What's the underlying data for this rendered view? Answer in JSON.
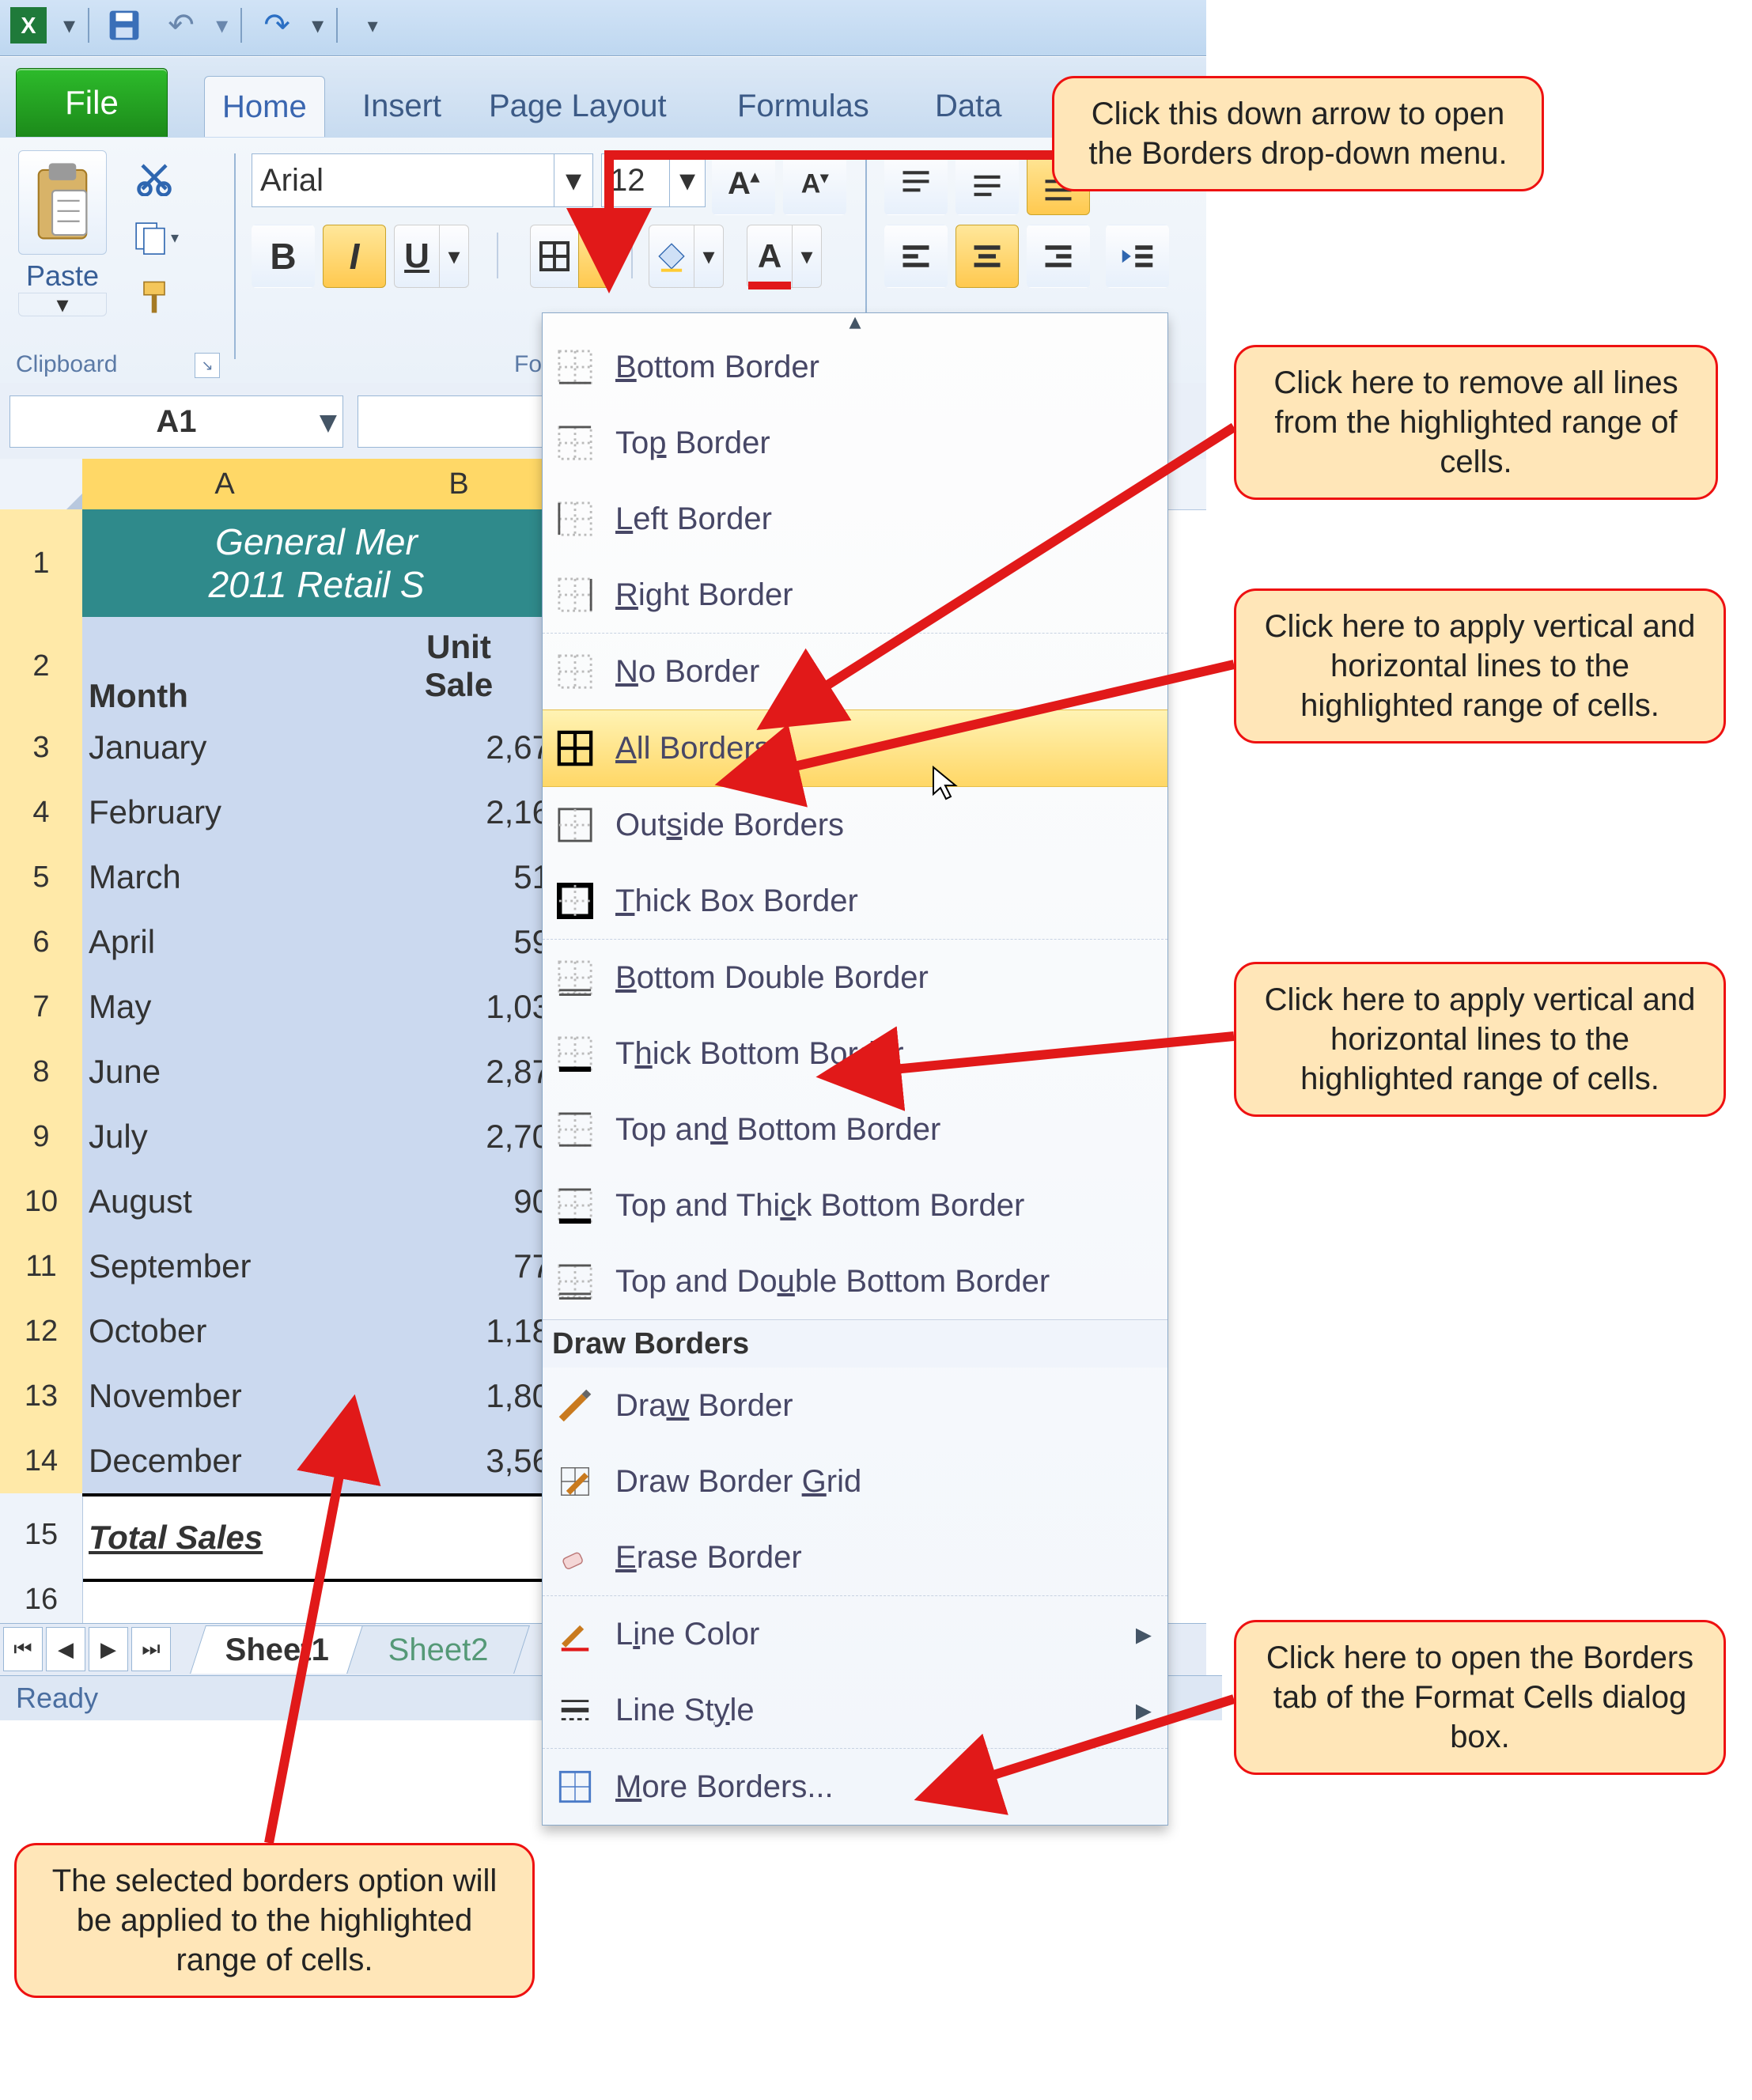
{
  "titlebar": {
    "app": "Microsoft Excel"
  },
  "tabs": {
    "file": "File",
    "items": [
      "Home",
      "Insert",
      "Page Layout",
      "Formulas",
      "Data"
    ],
    "active": "Home"
  },
  "ribbon": {
    "clipboard": {
      "paste": "Paste",
      "group": "Clipboard"
    },
    "font": {
      "name": "Arial",
      "size": "12",
      "group": "Fo",
      "bold": "B",
      "italic": "I",
      "underline": "U"
    }
  },
  "formula_bar": {
    "namebox": "A1"
  },
  "columns": [
    "A",
    "B"
  ],
  "rows_visible": [
    1,
    2,
    3,
    4,
    5,
    6,
    7,
    8,
    9,
    10,
    11,
    12,
    13,
    14,
    15,
    16
  ],
  "sheet": {
    "title_line1": "General Mer",
    "title_line2": "2011 Retail S",
    "col_titles": {
      "a": "Month",
      "b_line1": "Unit",
      "b_line2": "Sale"
    },
    "data": [
      {
        "month": "January",
        "b": "2,67"
      },
      {
        "month": "February",
        "b": "2,16"
      },
      {
        "month": "March",
        "b": "51"
      },
      {
        "month": "April",
        "b": "59"
      },
      {
        "month": "May",
        "b": "1,03"
      },
      {
        "month": "June",
        "b": "2,87"
      },
      {
        "month": "July",
        "b": "2,70"
      },
      {
        "month": "August",
        "b": "90"
      },
      {
        "month": "September",
        "b": "77"
      },
      {
        "month": "October",
        "b": "1,18"
      },
      {
        "month": "November",
        "b": "1,80"
      },
      {
        "month": "December",
        "b": "3,56"
      }
    ],
    "total_label": "Total Sales"
  },
  "sheet_tabs": {
    "active": "Sheet1",
    "other": "Sheet2"
  },
  "status": "Ready",
  "borders_menu": {
    "items": [
      {
        "key": "bottom",
        "label": "Bottom Border",
        "accel": "B"
      },
      {
        "key": "top",
        "label": "Top Border",
        "accel": "P"
      },
      {
        "key": "left",
        "label": "Left Border",
        "accel": "L"
      },
      {
        "key": "right",
        "label": "Right Border",
        "accel": "R"
      },
      {
        "key": "none",
        "label": "No Border",
        "accel": "N",
        "sep": true
      },
      {
        "key": "all",
        "label": "All Borders",
        "accel": "A",
        "hover": true
      },
      {
        "key": "outside",
        "label": "Outside Borders",
        "accel": "s"
      },
      {
        "key": "thickbox",
        "label": "Thick Box Border",
        "accel": "T"
      },
      {
        "key": "bottom2",
        "label": "Bottom Double Border",
        "accel": "B",
        "sep": true
      },
      {
        "key": "thickbottom",
        "label": "Thick Bottom Border",
        "accel": "h"
      },
      {
        "key": "topbottom",
        "label": "Top and Bottom Border",
        "accel": "d"
      },
      {
        "key": "topthickbottom",
        "label": "Top and Thick Bottom Border",
        "accel": "C"
      },
      {
        "key": "topdoublebottom",
        "label": "Top and Double Bottom Border",
        "accel": "u"
      }
    ],
    "section_header": "Draw Borders",
    "draw_items": [
      {
        "key": "drawborder",
        "label": "Draw Border",
        "accel": "W"
      },
      {
        "key": "drawgrid",
        "label": "Draw Border Grid",
        "accel": "G"
      },
      {
        "key": "erase",
        "label": "Erase Border",
        "accel": "E"
      },
      {
        "key": "linecolor",
        "label": "Line Color",
        "accel": "I",
        "sep": true,
        "sub": true
      },
      {
        "key": "linestyle",
        "label": "Line Style",
        "accel": "Y",
        "sub": true
      },
      {
        "key": "more",
        "label": "More Borders...",
        "accel": "M",
        "sep": true
      }
    ]
  },
  "callouts": {
    "top": "Click this down arrow to open the Borders drop-down menu.",
    "noborder": "Click here to remove all lines from the highlighted range of cells.",
    "allborders": "Click here to apply vertical and horizontal lines to the highlighted range of cells.",
    "thickbottom": "Click here to apply vertical and horizontal lines to the highlighted range of cells.",
    "moreborders": "Click here to open the Borders tab of the Format Cells dialog box.",
    "bottom": "The selected borders option will be applied to the highlighted range of cells."
  }
}
